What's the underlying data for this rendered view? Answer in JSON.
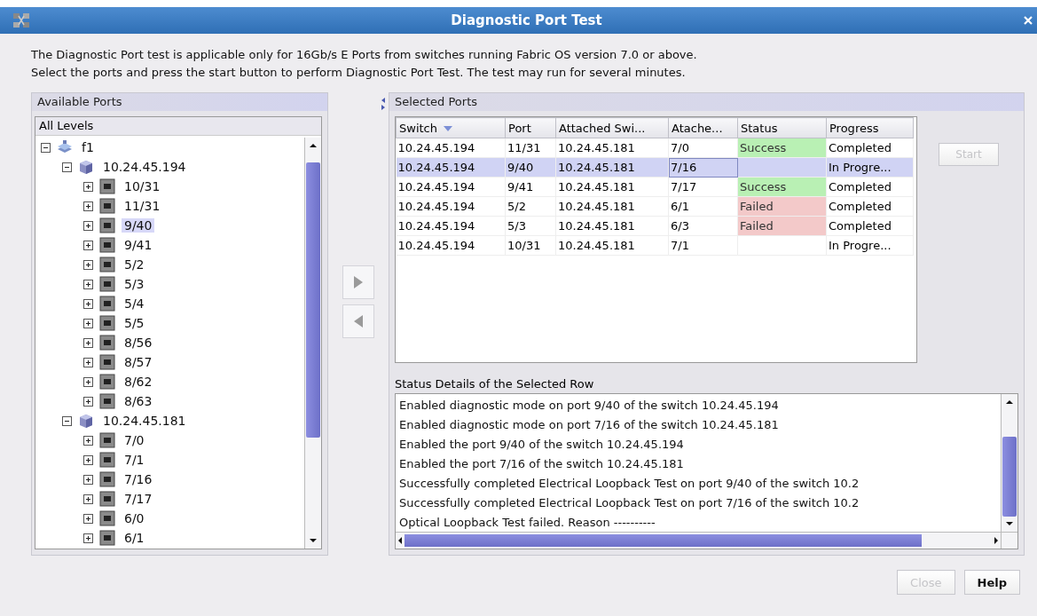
{
  "window": {
    "title": "Diagnostic Port Test"
  },
  "intro": [
    "The Diagnostic Port test is applicable only for 16Gb/s E Ports from switches running Fabric OS version 7.0 or above.",
    "Select the ports and press the start button to perform Diagnostic Port Test. The test may run for several minutes."
  ],
  "available_ports": {
    "title": "Available Ports",
    "header": "All Levels",
    "tree": [
      {
        "label": "f1",
        "kind": "fabric",
        "expanded": true,
        "selected": false,
        "children": [
          {
            "label": "10.24.45.194",
            "kind": "switch",
            "expanded": true,
            "selected": false,
            "children": [
              {
                "label": "10/31",
                "kind": "port",
                "expanded": false,
                "selected": false
              },
              {
                "label": "11/31",
                "kind": "port",
                "expanded": false,
                "selected": false
              },
              {
                "label": "9/40",
                "kind": "port",
                "expanded": false,
                "selected": true
              },
              {
                "label": "9/41",
                "kind": "port",
                "expanded": false,
                "selected": false
              },
              {
                "label": "5/2",
                "kind": "port",
                "expanded": false,
                "selected": false
              },
              {
                "label": "5/3",
                "kind": "port",
                "expanded": false,
                "selected": false
              },
              {
                "label": "5/4",
                "kind": "port",
                "expanded": false,
                "selected": false
              },
              {
                "label": "5/5",
                "kind": "port",
                "expanded": false,
                "selected": false
              },
              {
                "label": "8/56",
                "kind": "port",
                "expanded": false,
                "selected": false
              },
              {
                "label": "8/57",
                "kind": "port",
                "expanded": false,
                "selected": false
              },
              {
                "label": "8/62",
                "kind": "port",
                "expanded": false,
                "selected": false
              },
              {
                "label": "8/63",
                "kind": "port",
                "expanded": false,
                "selected": false
              }
            ]
          },
          {
            "label": "10.24.45.181",
            "kind": "switch",
            "expanded": true,
            "selected": false,
            "children": [
              {
                "label": "7/0",
                "kind": "port",
                "expanded": false,
                "selected": false
              },
              {
                "label": "7/1",
                "kind": "port",
                "expanded": false,
                "selected": false
              },
              {
                "label": "7/16",
                "kind": "port",
                "expanded": false,
                "selected": false
              },
              {
                "label": "7/17",
                "kind": "port",
                "expanded": false,
                "selected": false
              },
              {
                "label": "6/0",
                "kind": "port",
                "expanded": false,
                "selected": false
              },
              {
                "label": "6/1",
                "kind": "port",
                "expanded": false,
                "selected": false
              }
            ]
          }
        ]
      }
    ]
  },
  "selected_ports": {
    "title": "Selected Ports",
    "table": {
      "columns": [
        {
          "label": "Switch",
          "sorted": true
        },
        {
          "label": "Port",
          "sorted": false
        },
        {
          "label": "Attached Swi...",
          "sorted": false
        },
        {
          "label": "Atache...",
          "sorted": false
        },
        {
          "label": "Status",
          "sorted": false
        },
        {
          "label": "Progress",
          "sorted": false
        }
      ],
      "rows": [
        {
          "switch": "10.24.45.194",
          "port": "11/31",
          "attached_switch": "10.24.45.181",
          "column_4": "7/0",
          "status": {
            "text": "Success",
            "color": "#b9f0b4"
          },
          "progress": "Completed",
          "selected": false
        },
        {
          "switch": "10.24.45.194",
          "port": "9/40",
          "attached_switch": "10.24.45.181",
          "column_4": "7/16",
          "progress": "In Progre...",
          "selected": true
        },
        {
          "switch": "10.24.45.194",
          "port": "9/41",
          "attached_switch": "10.24.45.181",
          "column_4": "7/17",
          "status": {
            "text": "Success",
            "color": "#b9f0b4"
          },
          "progress": "Completed",
          "selected": false
        },
        {
          "switch": "10.24.45.194",
          "port": "5/2",
          "attached_switch": "10.24.45.181",
          "column_4": "6/1",
          "status": {
            "text": "Failed",
            "color": "#f3c9c9"
          },
          "progress": "Completed",
          "selected": false
        },
        {
          "switch": "10.24.45.194",
          "port": "5/3",
          "attached_switch": "10.24.45.181",
          "column_4": "6/3",
          "status": {
            "text": "Failed",
            "color": "#f3c9c9"
          },
          "progress": "Completed",
          "selected": false
        },
        {
          "switch": "10.24.45.194",
          "port": "10/31",
          "attached_switch": "10.24.45.181",
          "column_4": "7/1",
          "progress": "In Progre...",
          "selected": false
        }
      ]
    },
    "start_button": {
      "label": "Start",
      "disabled": true
    }
  },
  "status_details": {
    "title": "Status Details of the Selected Row",
    "lines": [
      "Enabled diagnostic mode on port 9/40 of the switch 10.24.45.194",
      "Enabled diagnostic mode on port 7/16 of the switch 10.24.45.181",
      "Enabled the port 9/40 of the switch 10.24.45.194",
      "Enabled the port 7/16 of the switch 10.24.45.181",
      "Successfully completed Electrical Loopback Test on port 9/40 of the switch 10.2",
      "Successfully completed Electrical Loopback Test on port 7/16 of the switch 10.2",
      "Optical Loopback Test failed. Reason ----------"
    ]
  },
  "buttons": [
    {
      "label": "Close",
      "disabled": true
    },
    {
      "label": "Help",
      "disabled": false
    }
  ]
}
